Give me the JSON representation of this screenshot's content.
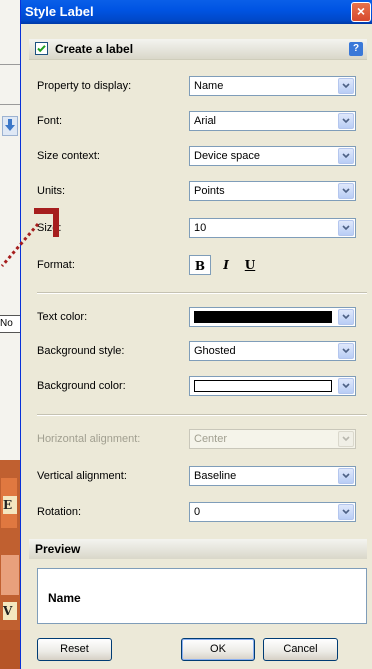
{
  "window": {
    "title": "Style Label",
    "close_label": "×"
  },
  "section": {
    "title": "Create a label",
    "checked": true,
    "help_label": "?"
  },
  "background": {
    "partial_text_no": "No",
    "partial_map_text_1": "E",
    "partial_map_text_2": "V"
  },
  "fields": {
    "property": {
      "label": "Property to display:",
      "value": "Name"
    },
    "font": {
      "label": "Font:",
      "value": "Arial"
    },
    "size_context": {
      "label": "Size context:",
      "value": "Device space"
    },
    "units": {
      "label": "Units:",
      "value": "Points"
    },
    "size": {
      "label": "Size:",
      "value": "10"
    },
    "format": {
      "label": "Format:",
      "bold": "B",
      "italic": "I",
      "underline": "U"
    },
    "text_color": {
      "label": "Text color:",
      "color": "#000000"
    },
    "background_style": {
      "label": "Background style:",
      "value": "Ghosted"
    },
    "background_color": {
      "label": "Background color:",
      "color": "#ffffff"
    },
    "horizontal_alignment": {
      "label": "Horizontal alignment:",
      "value": "Center",
      "disabled": true
    },
    "vertical_alignment": {
      "label": "Vertical alignment:",
      "value": "Baseline"
    },
    "rotation": {
      "label": "Rotation:",
      "value": "0"
    }
  },
  "preview": {
    "title": "Preview",
    "text": "Name"
  },
  "buttons": {
    "reset": "Reset",
    "ok": "OK",
    "cancel": "Cancel"
  },
  "colors": {
    "titlebar": "#0054e3",
    "dialog_bg": "#ece9d8",
    "accent_red": "#a61e1e"
  }
}
